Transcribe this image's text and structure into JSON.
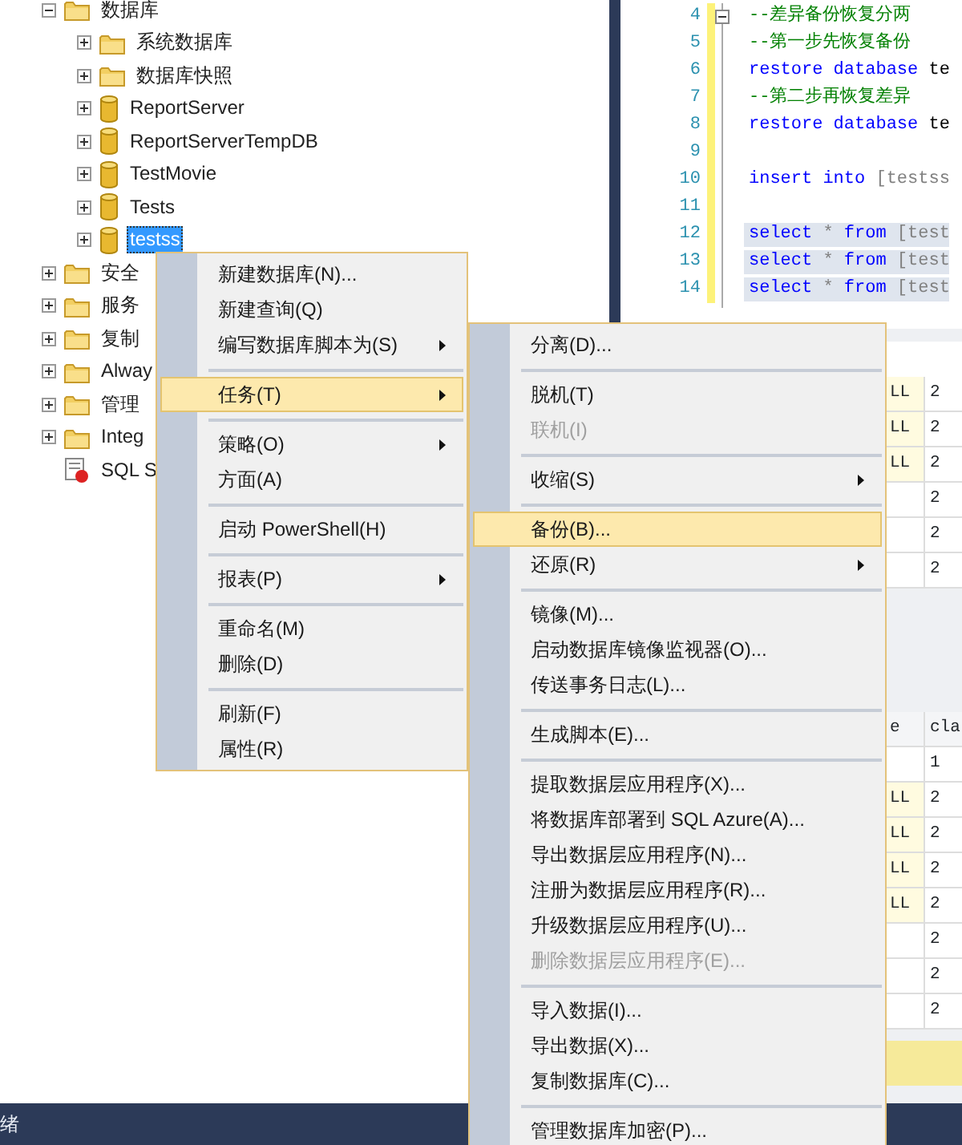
{
  "tree": [
    {
      "label": "数据库",
      "kind": "folder",
      "expanded": true,
      "selected": false,
      "children": [
        {
          "label": "系统数据库",
          "kind": "folder",
          "expanded": false,
          "selected": false
        },
        {
          "label": "数据库快照",
          "kind": "folder",
          "expanded": false,
          "selected": false
        },
        {
          "label": "ReportServer",
          "kind": "database",
          "expanded": false,
          "selected": false
        },
        {
          "label": "ReportServerTempDB",
          "kind": "database",
          "expanded": false,
          "selected": false
        },
        {
          "label": "TestMovie",
          "kind": "database",
          "expanded": false,
          "selected": false
        },
        {
          "label": "Tests",
          "kind": "database",
          "expanded": false,
          "selected": false
        },
        {
          "label": "testss",
          "kind": "database",
          "expanded": false,
          "selected": true
        }
      ]
    },
    {
      "label": "安全",
      "kind": "folder",
      "expanded": false,
      "selected": false
    },
    {
      "label": "服务",
      "kind": "folder",
      "expanded": false,
      "selected": false
    },
    {
      "label": "复制",
      "kind": "folder",
      "expanded": false,
      "selected": false
    },
    {
      "label": "Alway",
      "kind": "folder",
      "expanded": false,
      "selected": false
    },
    {
      "label": "管理",
      "kind": "folder",
      "expanded": false,
      "selected": false
    },
    {
      "label": "Integ",
      "kind": "folder",
      "expanded": false,
      "selected": false
    },
    {
      "label": "SQL S",
      "kind": "agent",
      "selected": false
    }
  ],
  "editor": {
    "lines": [
      {
        "number": "4",
        "fold_start": true,
        "tokens": [
          {
            "kind": "comment",
            "text": "--差异备份恢复分两"
          }
        ]
      },
      {
        "number": "5",
        "tokens": [
          {
            "kind": "comment",
            "text": "--第一步先恢复备份"
          }
        ]
      },
      {
        "number": "6",
        "tokens": [
          {
            "kind": "keyword",
            "text": "restore database"
          },
          {
            "kind": "text",
            "text": " te"
          }
        ]
      },
      {
        "number": "7",
        "tokens": [
          {
            "kind": "comment",
            "text": "--第二步再恢复差异"
          }
        ]
      },
      {
        "number": "8",
        "tokens": [
          {
            "kind": "keyword",
            "text": "restore database"
          },
          {
            "kind": "text",
            "text": " te"
          }
        ]
      },
      {
        "number": "9"
      },
      {
        "number": "10",
        "tokens": [
          {
            "kind": "keyword",
            "text": "insert into"
          },
          {
            "kind": "identifier",
            "text": " [testss"
          }
        ]
      },
      {
        "number": "11"
      },
      {
        "number": "12",
        "selected": true,
        "tokens": [
          {
            "kind": "keyword",
            "text": "select"
          },
          {
            "kind": "identifier",
            "text": " * "
          },
          {
            "kind": "keyword",
            "text": "from"
          },
          {
            "kind": "identifier",
            "text": " [test"
          }
        ]
      },
      {
        "number": "13",
        "selected": true,
        "tokens": [
          {
            "kind": "keyword",
            "text": "select"
          },
          {
            "kind": "identifier",
            "text": " * "
          },
          {
            "kind": "keyword",
            "text": "from"
          },
          {
            "kind": "identifier",
            "text": " [test"
          }
        ]
      },
      {
        "number": "14",
        "selected": true,
        "tokens": [
          {
            "kind": "keyword",
            "text": "select"
          },
          {
            "kind": "identifier",
            "text": " * "
          },
          {
            "kind": "keyword",
            "text": "from"
          },
          {
            "kind": "identifier",
            "text": " [test"
          }
        ]
      }
    ]
  },
  "results": [
    {
      "rows": [
        {
          "column_1": "LL",
          "column_2": "2"
        },
        {
          "column_1": "LL",
          "column_2": "2"
        },
        {
          "column_1": "LL",
          "column_2": "2"
        },
        {
          "column_2": "2"
        },
        {
          "column_2": "2"
        },
        {
          "column_2": "2"
        }
      ]
    },
    {
      "columns": [
        "e",
        "cla"
      ],
      "rows": [
        {
          "column_2": "1"
        },
        {
          "column_1": "LL",
          "column_2": "2"
        },
        {
          "column_1": "LL",
          "column_2": "2"
        },
        {
          "column_1": "LL",
          "column_2": "2"
        },
        {
          "column_1": "LL",
          "column_2": "2"
        },
        {
          "column_2": "2"
        },
        {
          "column_2": "2"
        },
        {
          "column_2": "2"
        }
      ]
    }
  ],
  "context_menu": {
    "items": [
      {
        "kind": "item",
        "label": "新建数据库(N)...",
        "submenu": false,
        "selected": false,
        "disabled": false
      },
      {
        "kind": "item",
        "label": "新建查询(Q)",
        "submenu": false,
        "selected": false,
        "disabled": false
      },
      {
        "kind": "item",
        "label": "编写数据库脚本为(S)",
        "submenu": true,
        "selected": false,
        "disabled": false
      },
      {
        "kind": "separator"
      },
      {
        "kind": "item",
        "label": "任务(T)",
        "submenu": true,
        "selected": true,
        "disabled": false
      },
      {
        "kind": "separator"
      },
      {
        "kind": "item",
        "label": "策略(O)",
        "submenu": true,
        "selected": false,
        "disabled": false
      },
      {
        "kind": "item",
        "label": "方面(A)",
        "submenu": false,
        "selected": false,
        "disabled": false
      },
      {
        "kind": "separator"
      },
      {
        "kind": "item",
        "label": "启动 PowerShell(H)",
        "submenu": false,
        "selected": false,
        "disabled": false
      },
      {
        "kind": "separator"
      },
      {
        "kind": "item",
        "label": "报表(P)",
        "submenu": true,
        "selected": false,
        "disabled": false
      },
      {
        "kind": "separator"
      },
      {
        "kind": "item",
        "label": "重命名(M)",
        "submenu": false,
        "selected": false,
        "disabled": false
      },
      {
        "kind": "item",
        "label": "删除(D)",
        "submenu": false,
        "selected": false,
        "disabled": false
      },
      {
        "kind": "separator"
      },
      {
        "kind": "item",
        "label": "刷新(F)",
        "submenu": false,
        "selected": false,
        "disabled": false
      },
      {
        "kind": "item",
        "label": "属性(R)",
        "submenu": false,
        "selected": false,
        "disabled": false
      }
    ]
  },
  "tasks_submenu": {
    "items": [
      {
        "kind": "item",
        "label": "分离(D)...",
        "submenu": false,
        "selected": false,
        "disabled": false
      },
      {
        "kind": "separator"
      },
      {
        "kind": "item",
        "label": "脱机(T)",
        "submenu": false,
        "selected": false,
        "disabled": false
      },
      {
        "kind": "item",
        "label": "联机(I)",
        "submenu": false,
        "selected": false,
        "disabled": true
      },
      {
        "kind": "separator"
      },
      {
        "kind": "item",
        "label": "收缩(S)",
        "submenu": true,
        "selected": false,
        "disabled": false
      },
      {
        "kind": "separator"
      },
      {
        "kind": "item",
        "label": "备份(B)...",
        "submenu": false,
        "selected": true,
        "disabled": false
      },
      {
        "kind": "item",
        "label": "还原(R)",
        "submenu": true,
        "selected": false,
        "disabled": false
      },
      {
        "kind": "separator"
      },
      {
        "kind": "item",
        "label": "镜像(M)...",
        "submenu": false,
        "selected": false,
        "disabled": false
      },
      {
        "kind": "item",
        "label": "启动数据库镜像监视器(O)...",
        "submenu": false,
        "selected": false,
        "disabled": false
      },
      {
        "kind": "item",
        "label": "传送事务日志(L)...",
        "submenu": false,
        "selected": false,
        "disabled": false
      },
      {
        "kind": "separator"
      },
      {
        "kind": "item",
        "label": "生成脚本(E)...",
        "submenu": false,
        "selected": false,
        "disabled": false
      },
      {
        "kind": "separator"
      },
      {
        "kind": "item",
        "label": "提取数据层应用程序(X)...",
        "submenu": false,
        "selected": false,
        "disabled": false
      },
      {
        "kind": "item",
        "label": "将数据库部署到 SQL Azure(A)...",
        "submenu": false,
        "selected": false,
        "disabled": false
      },
      {
        "kind": "item",
        "label": "导出数据层应用程序(N)...",
        "submenu": false,
        "selected": false,
        "disabled": false
      },
      {
        "kind": "item",
        "label": "注册为数据层应用程序(R)...",
        "submenu": false,
        "selected": false,
        "disabled": false
      },
      {
        "kind": "item",
        "label": "升级数据层应用程序(U)...",
        "submenu": false,
        "selected": false,
        "disabled": false
      },
      {
        "kind": "item",
        "label": "删除数据层应用程序(E)...",
        "submenu": false,
        "selected": false,
        "disabled": true
      },
      {
        "kind": "separator"
      },
      {
        "kind": "item",
        "label": "导入数据(I)...",
        "submenu": false,
        "selected": false,
        "disabled": false
      },
      {
        "kind": "item",
        "label": "导出数据(X)...",
        "submenu": false,
        "selected": false,
        "disabled": false
      },
      {
        "kind": "item",
        "label": "复制数据库(C)...",
        "submenu": false,
        "selected": false,
        "disabled": false
      },
      {
        "kind": "separator"
      },
      {
        "kind": "item",
        "label": "管理数据库加密(P)...",
        "submenu": false,
        "selected": false,
        "disabled": false
      }
    ]
  },
  "status_bar": {
    "text": "绪"
  }
}
